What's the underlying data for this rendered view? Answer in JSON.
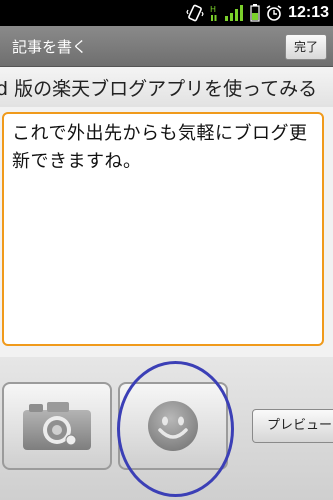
{
  "status_bar": {
    "time": "12:13",
    "icons": [
      "vibrate-icon",
      "hspa-icon",
      "signal-icon",
      "battery-icon",
      "alarm-icon"
    ]
  },
  "title_bar": {
    "title": "記事を書く",
    "done_label": "完了"
  },
  "editor": {
    "subject_value": "d 版の楽天ブログアプリを使ってみる",
    "body_value": "これで外出先からも気軽にブログ更新できますね。",
    "focus_color": "#f09a1b"
  },
  "toolbar": {
    "camera_icon": "camera-icon",
    "emoji_icon": "smiley-icon",
    "preview_label": "プレビュー",
    "highlight_color": "#3b3fb6"
  }
}
